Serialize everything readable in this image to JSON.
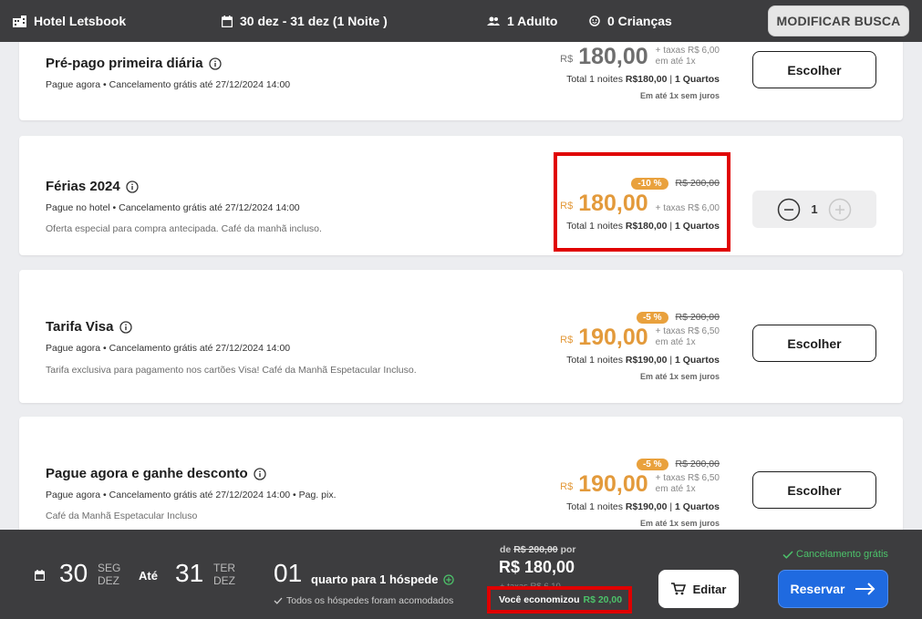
{
  "topbar": {
    "hotel": "Hotel Letsbook",
    "dates": "30 dez - 31 dez (1 Noite )",
    "adults": "1 Adulto",
    "children": "0 Crianças",
    "modify_label": "MODIFICAR BUSCA"
  },
  "rates": [
    {
      "title": "Pré-pago primeira diária",
      "conditions": "Pague agora • Cancelamento grátis até 27/12/2024 14:00",
      "description": "",
      "currency": "R$",
      "price": "180,00",
      "taxes": "+ taxas R$ 6,00",
      "installment_short": "em até 1x",
      "total_prefix": "Total 1 noites",
      "total_value": "R$180,00",
      "rooms": "1 Quartos",
      "installment_note": "Em até 1x sem juros",
      "button_label": "Escolher"
    },
    {
      "title": "Férias 2024",
      "conditions": "Pague no hotel • Cancelamento grátis até 27/12/2024 14:00",
      "description": "Oferta especial para compra antecipada. Café da manhã incluso.",
      "discount": "-10 %",
      "old_price": "R$ 200,00",
      "currency": "R$",
      "price": "180,00",
      "taxes": "+ taxas R$ 6,00",
      "total_prefix": "Total 1 noites",
      "total_value": "R$180,00",
      "rooms": "1 Quartos",
      "quantity": "1"
    },
    {
      "title": "Tarifa Visa",
      "conditions": "Pague agora • Cancelamento grátis até 27/12/2024 14:00",
      "description": "Tarifa exclusiva para pagamento nos cartões Visa! Café da Manhã Espetacular Incluso.",
      "discount": "-5 %",
      "old_price": "R$ 200,00",
      "currency": "R$",
      "price": "190,00",
      "taxes": "+ taxas R$ 6,50",
      "installment_short": "em até 1x",
      "total_prefix": "Total 1 noites",
      "total_value": "R$190,00",
      "rooms": "1 Quartos",
      "installment_note": "Em até 1x sem juros",
      "button_label": "Escolher"
    },
    {
      "title": "Pague agora e ganhe desconto",
      "conditions": "Pague agora • Cancelamento grátis até 27/12/2024 14:00 • Pag. pix.",
      "description": "Café da Manhã Espetacular Incluso",
      "discount": "-5 %",
      "old_price": "R$ 200,00",
      "currency": "R$",
      "price": "190,00",
      "taxes": "+ taxas R$ 6,50",
      "installment_short": "em até 1x",
      "total_prefix": "Total 1 noites",
      "total_value": "R$190,00",
      "rooms": "1 Quartos",
      "installment_note": "Em até 1x sem juros",
      "button_label": "Escolher"
    }
  ],
  "summary": {
    "checkin_day": "30",
    "checkin_weekday": "SEG",
    "checkin_month": "DEZ",
    "until": "Até",
    "checkout_day": "31",
    "checkout_weekday": "TER",
    "checkout_month": "DEZ",
    "rooms_count": "01",
    "rooms_text": "quarto para 1 hóspede",
    "accommodated": "Todos os hóspedes foram acomodados",
    "from_label": "de",
    "from_old_price": "R$ 200,00",
    "from_suffix": "por",
    "total": "R$ 180,00",
    "tax_hint": "+ taxas R$ 6,10",
    "saved_label": "Você economizou",
    "saved_value": "R$ 20,00",
    "edit_label": "Editar",
    "free_cancel": "Cancelamento grátis",
    "reserve_label": "Reservar"
  },
  "colors": {
    "bar": "#3d3d3f",
    "accent_orange": "#e39a3b",
    "primary_blue": "#1f6ae0",
    "success_green": "#4cc26a",
    "highlight_red": "#e00000"
  }
}
